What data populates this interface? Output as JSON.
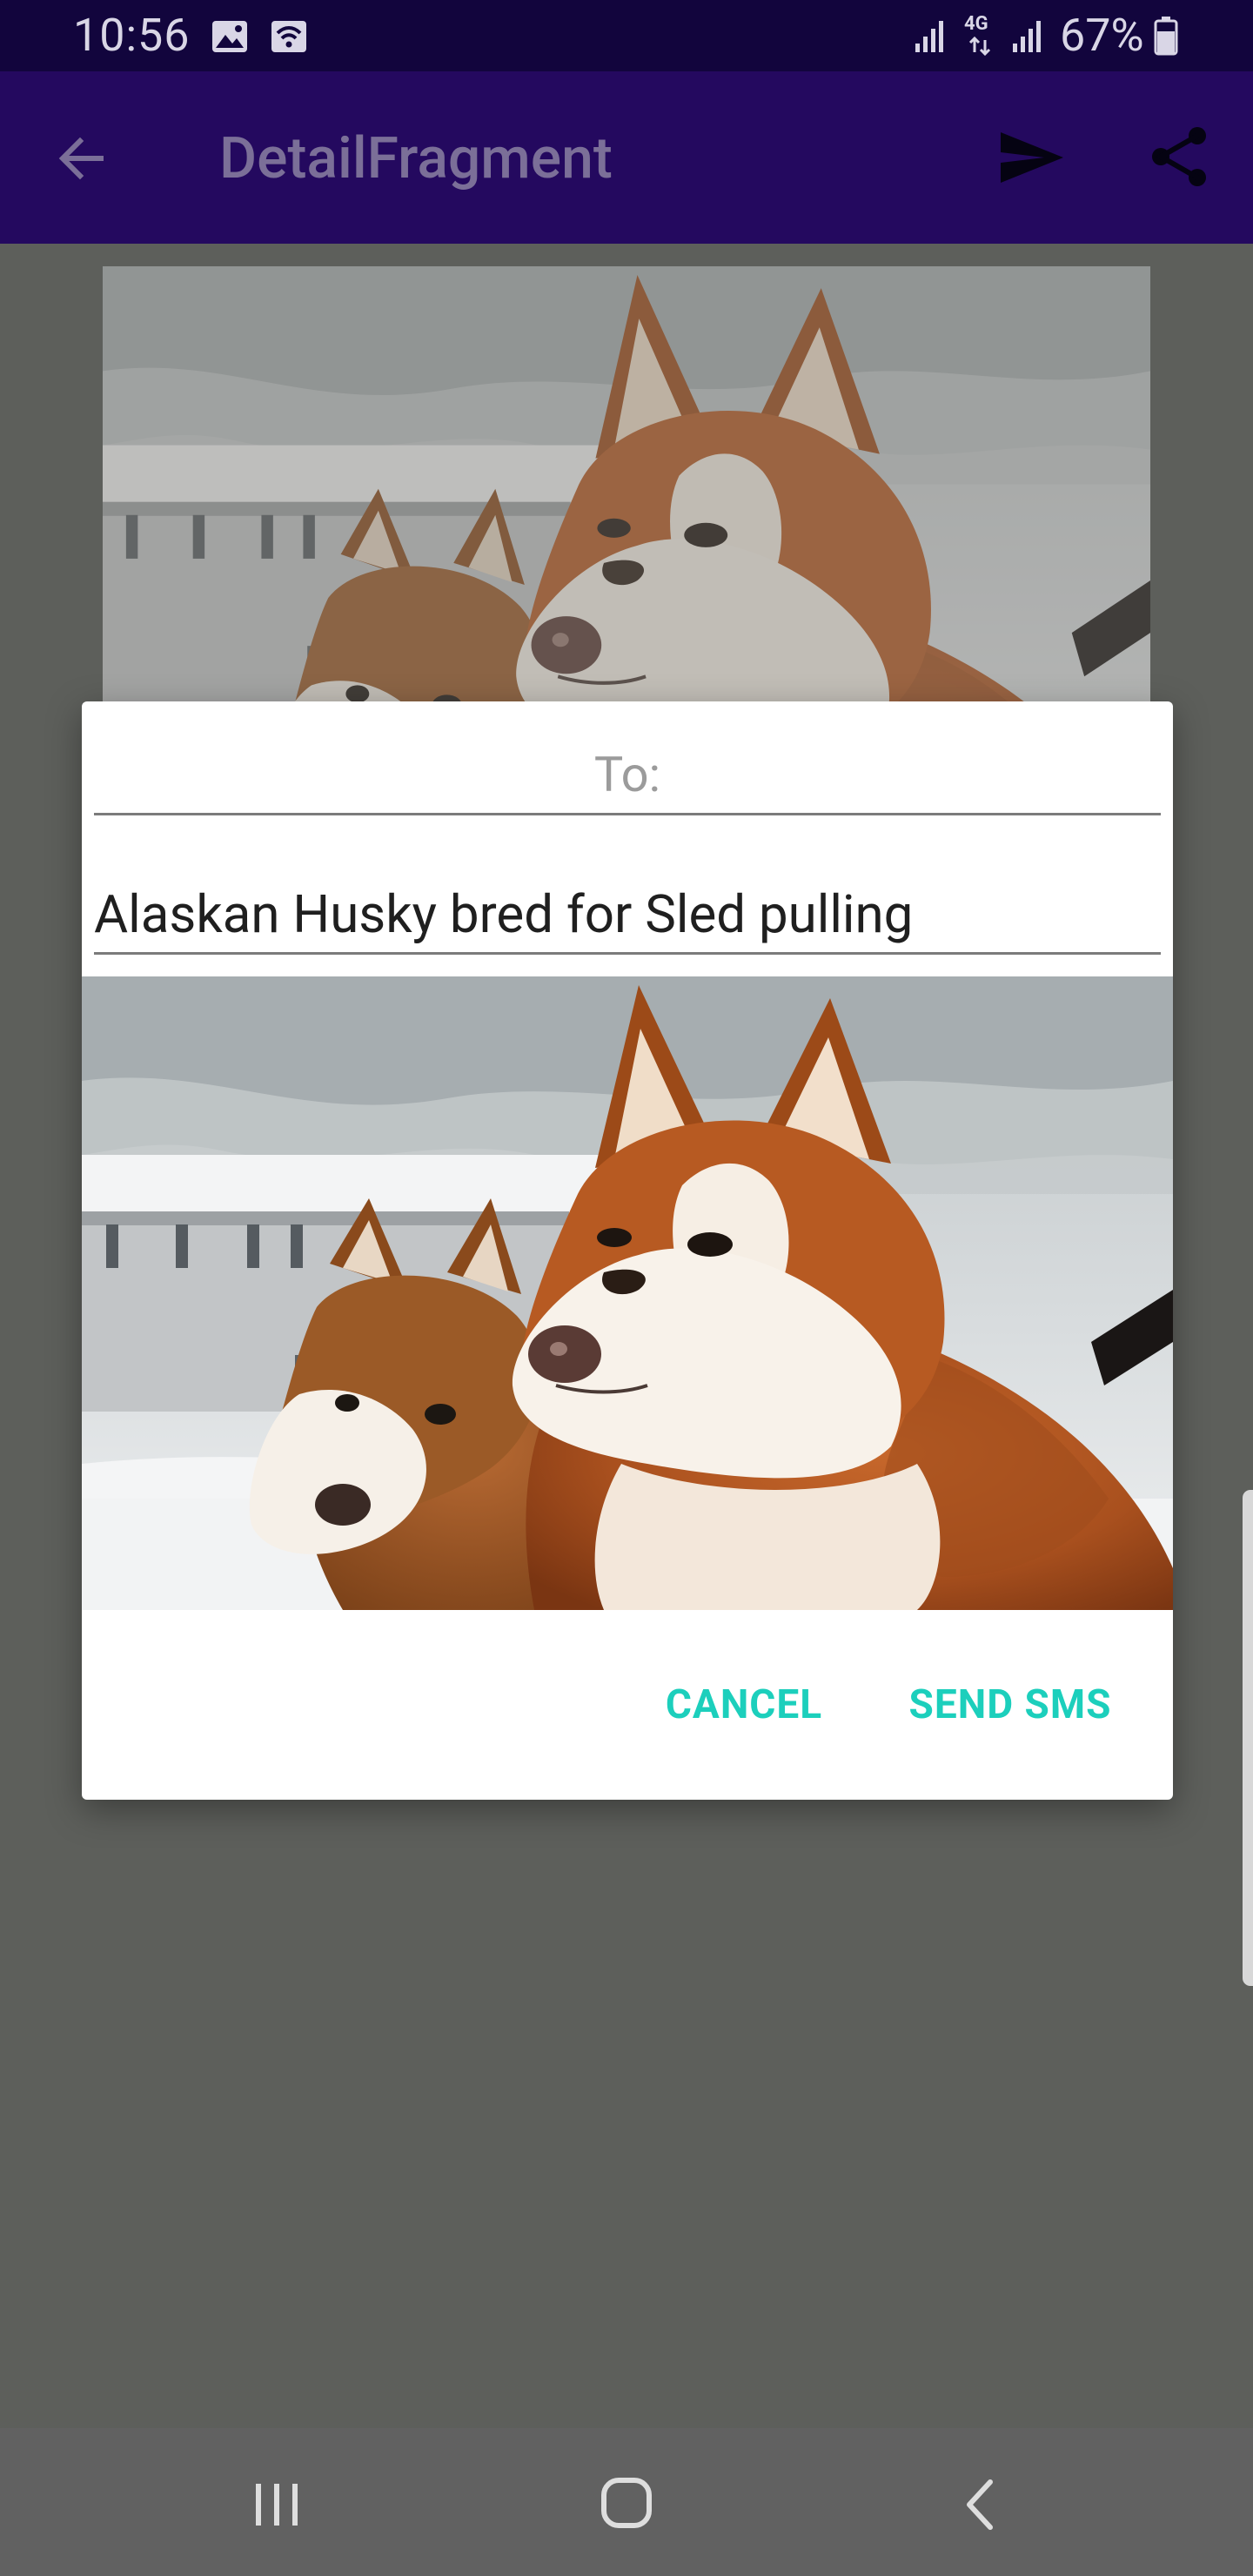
{
  "status_bar": {
    "time": "10:56",
    "battery_percent": "67%",
    "network_type": "4G",
    "icons": [
      "image-notification-icon",
      "wifi-calling-icon",
      "signal-icon",
      "network-4g-icon",
      "signal-icon",
      "battery-icon"
    ]
  },
  "app_bar": {
    "title": "DetailFragment",
    "icons": [
      "back-arrow-icon",
      "send-icon",
      "share-icon"
    ]
  },
  "dialog": {
    "to_placeholder": "To:",
    "to_value": "",
    "message_value": "Alaskan Husky bred for Sled pulling",
    "image_description": "two husky dogs in snow",
    "cancel_label": "CANCEL",
    "send_label": "SEND SMS"
  },
  "navigation_bar": {
    "icons": [
      "recents-icon",
      "home-icon",
      "back-icon"
    ]
  },
  "colors": {
    "status_bar": "#12053d",
    "app_bar": "#24095f",
    "scrim_background": "#5d5f5b",
    "dialog_accent": "#1ccfbc",
    "navigation_bar": "#616161"
  }
}
